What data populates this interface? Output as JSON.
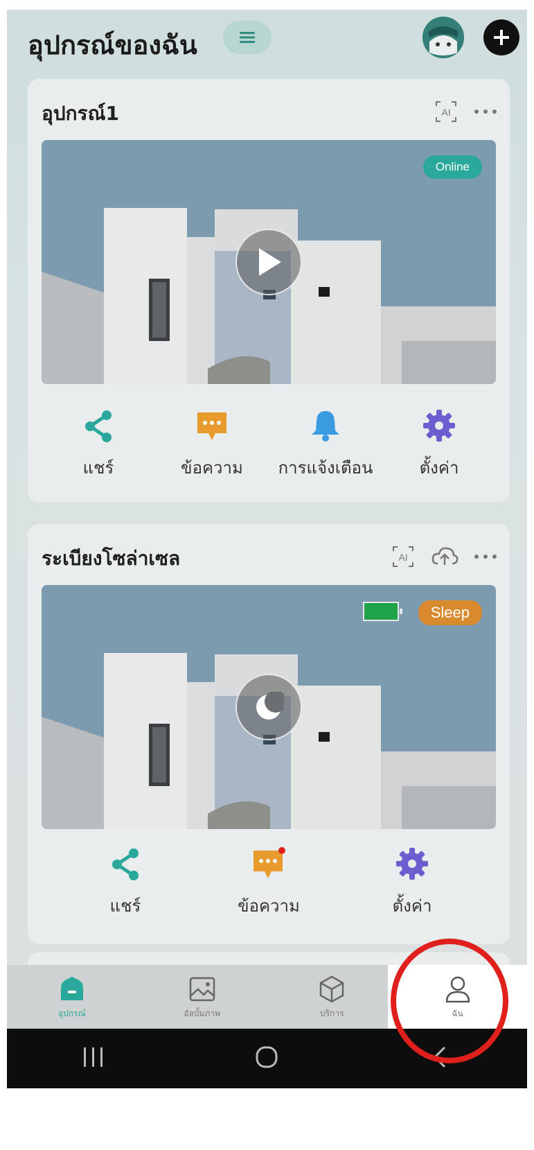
{
  "header": {
    "title": "อุปกรณ์ของฉัน",
    "menu_icon": "list-icon",
    "avatar_icon": "robot-avatar-icon",
    "add_icon": "plus-icon"
  },
  "devices": [
    {
      "name": "อุปกรณ์1",
      "status": "Online",
      "status_color": "#2aa89b",
      "center_icon": "play-icon",
      "icons": [
        "ai-icon",
        "more-icon"
      ],
      "actions": [
        {
          "label": "แชร์",
          "icon": "share-icon",
          "color": "#2aa89b"
        },
        {
          "label": "ข้อความ",
          "icon": "message-icon",
          "color": "#e69b2c"
        },
        {
          "label": "การแจ้งเตือน",
          "icon": "bell-icon",
          "color": "#3a9be0"
        },
        {
          "label": "ตั้งค่า",
          "icon": "gear-icon",
          "color": "#6b5fd0"
        }
      ]
    },
    {
      "name": "ระเบียงโซล่าเซล",
      "status": "Sleep",
      "status_color": "#d98a2e",
      "battery_color": "#1ea24a",
      "center_icon": "moon-icon",
      "icons": [
        "ai-icon",
        "cloud-upload-icon",
        "more-icon"
      ],
      "actions": [
        {
          "label": "แชร์",
          "icon": "share-icon",
          "color": "#2aa89b"
        },
        {
          "label": "ข้อความ",
          "icon": "message-icon",
          "color": "#e69b2c",
          "badge": true
        },
        {
          "label": "ตั้งค่า",
          "icon": "gear-icon",
          "color": "#6b5fd0"
        }
      ]
    }
  ],
  "tabbar": {
    "items": [
      {
        "label": "อุปกรณ์",
        "icon": "home-icon",
        "active": true
      },
      {
        "label": "อัลบั้มภาพ",
        "icon": "album-icon",
        "active": false
      },
      {
        "label": "บริการ",
        "icon": "cube-icon",
        "active": false
      },
      {
        "label": "ฉัน",
        "icon": "user-icon",
        "active": false
      }
    ]
  },
  "system_nav": [
    "recent-apps-icon",
    "home-circle-icon",
    "back-icon"
  ],
  "annotation_color": "#e0201c"
}
